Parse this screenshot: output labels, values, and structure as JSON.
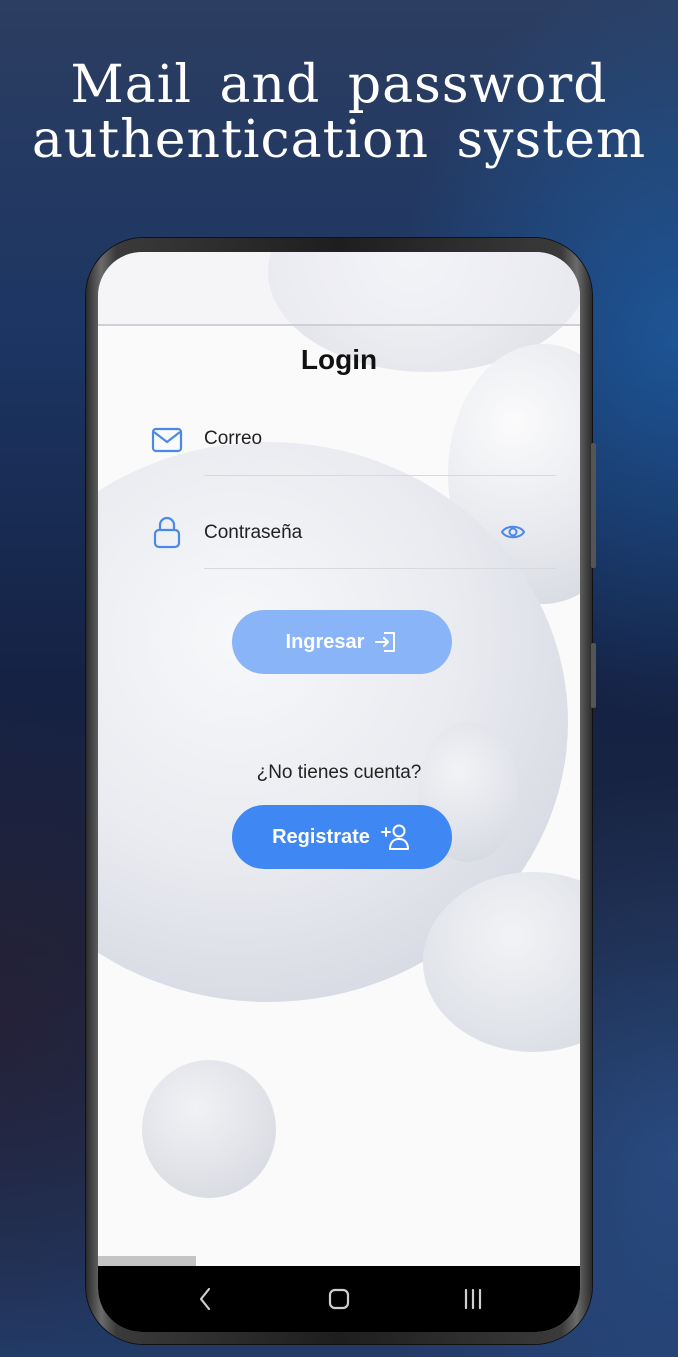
{
  "promo": {
    "headline_line1": "Mail and password",
    "headline_line2": "authentication system"
  },
  "login": {
    "title": "Login",
    "email_label": "Correo",
    "password_label": "Contraseña",
    "submit_label": "Ingresar",
    "no_account_text": "¿No tienes cuenta?",
    "register_label": "Registrate"
  },
  "icons": {
    "email": "mail-icon",
    "password": "lock-icon",
    "visibility": "eye-icon",
    "submit": "login-icon",
    "register": "add-user-icon",
    "nav_back": "back-icon",
    "nav_home": "home-icon",
    "nav_recents": "recents-icon"
  },
  "colors": {
    "accent": "#3f87f3",
    "accent_disabled": "#8ab4f8",
    "icon_blue": "#4a89e8"
  }
}
